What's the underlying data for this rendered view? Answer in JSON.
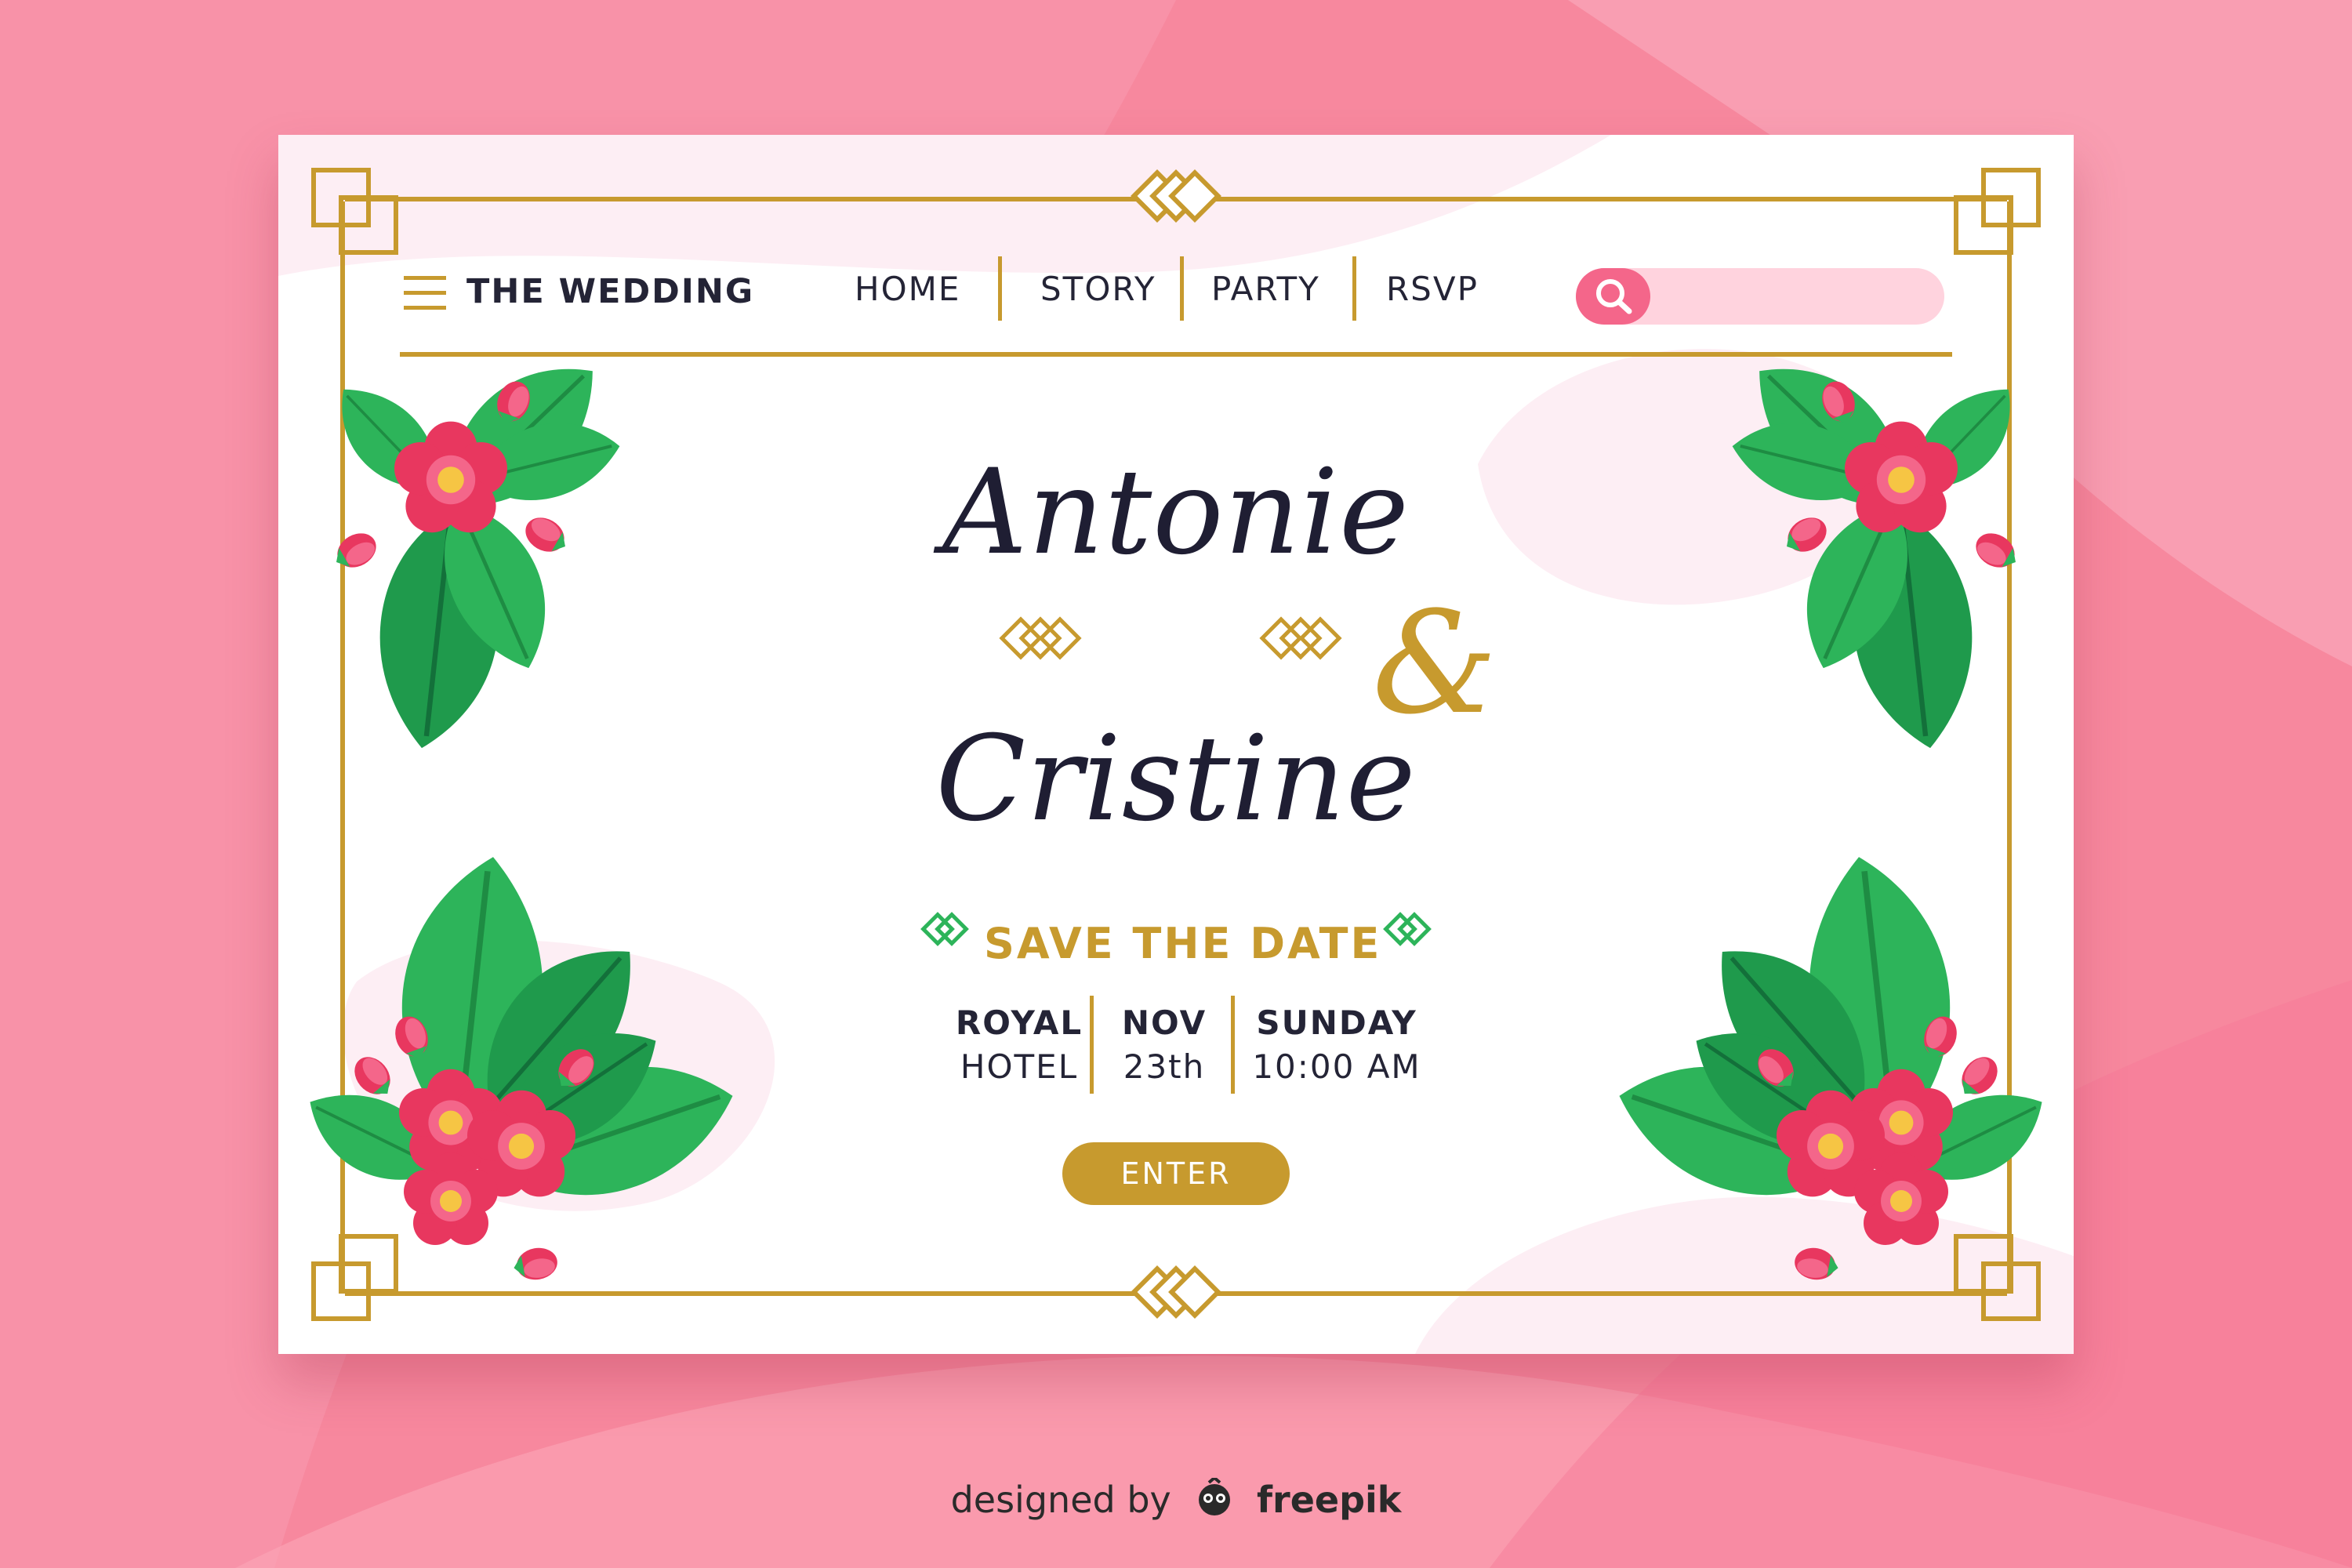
{
  "header": {
    "brand": "THE WEDDING",
    "nav": [
      "HOME",
      "STORY",
      "PARTY",
      "RSVP"
    ],
    "search_placeholder": ""
  },
  "hero": {
    "name_1": "Antonie",
    "ampersand": "&",
    "name_2": "Cristine",
    "save_the_date": "SAVE THE DATE"
  },
  "details": {
    "venue": [
      "ROYAL",
      "HOTEL"
    ],
    "date": [
      "NOV",
      "23th"
    ],
    "day_time": [
      "SUNDAY",
      "10:00 AM"
    ]
  },
  "cta": {
    "enter": "ENTER"
  },
  "credit": {
    "prefix": "designed by",
    "brand": "freepik"
  },
  "icons": {
    "menu": "hamburger-menu-icon",
    "search": "magnifier-icon",
    "logo": "freepik-logo-icon"
  },
  "colors": {
    "background": "#f7889e",
    "card": "#ffffff",
    "gold": "#c79a2e",
    "search_accent": "#f4668a",
    "flower": "#e8375f",
    "leaf": "#2db45a",
    "text_dark": "#242436"
  }
}
